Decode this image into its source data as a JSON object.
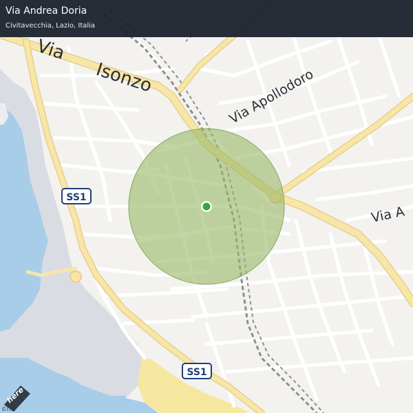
{
  "location": {
    "street": "Via Andrea Doria",
    "place": "Civitavecchia, Lazio, Italia"
  },
  "road_labels": {
    "via_isonzo_part1": "Via",
    "via_isonzo_part2": "Isonzo",
    "via_apollodoro": "Via Apollodoro",
    "via_a_partial": "Via A"
  },
  "route_shields": {
    "ss1_upper": "SS1",
    "ss1_lower": "SS1"
  },
  "branding": {
    "logo": "here",
    "copyright": "©ITA"
  },
  "colors": {
    "land": "#f3f2ef",
    "sea": "#a8cde8",
    "port_area": "#dadce3",
    "beach": "#f6e7a0",
    "main_road": "#f8e6a8",
    "minor_road": "#ffffff",
    "railway": "#8e8e8e",
    "accuracy_circle": "#97b866",
    "location_dot": "#2eaa3e",
    "header_bg": "#1b222c"
  },
  "icons": {
    "location_marker": "location-dot-icon",
    "accuracy_area": "accuracy-circle",
    "route_shield": "route-shield-icon"
  }
}
